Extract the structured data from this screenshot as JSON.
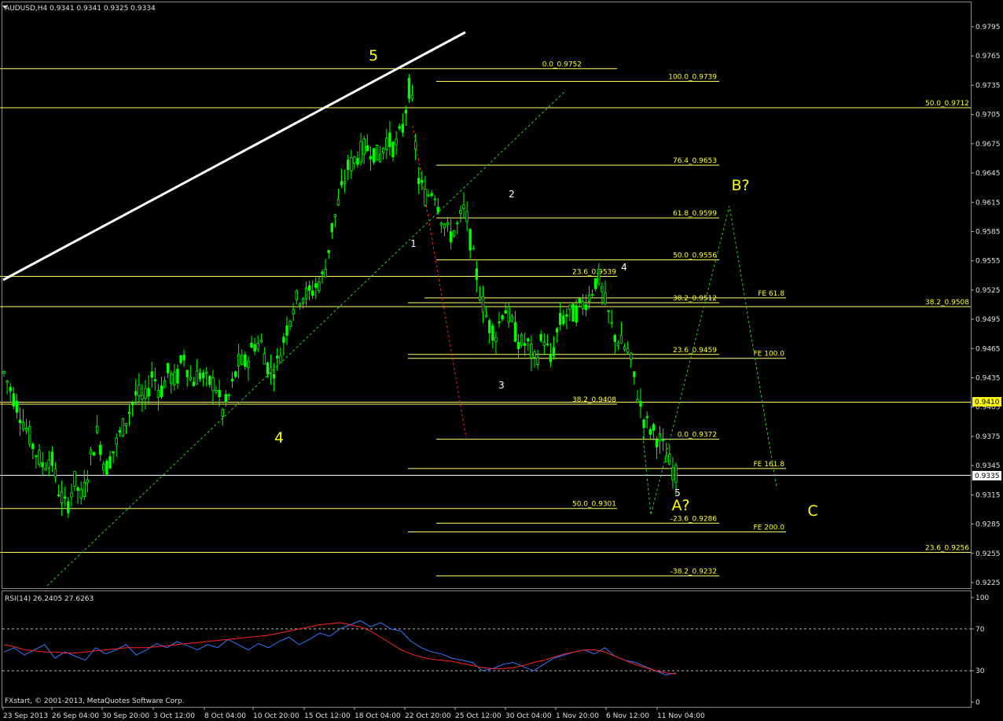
{
  "symbol_header": "AUDUSD,H4  0.9341 0.9341 0.9325 0.9334",
  "rsi_header": "RSI(14) 26.2405 27.6263",
  "copyright": "FXstart, © 2001-2013, MetaQuotes Software Corp.",
  "current_price_label": "0.9335",
  "highlight_price_label": "0.9410",
  "colors": {
    "background": "#000000",
    "candle": "#00ff00",
    "fib_line": "#ffff66",
    "wave_label": "#ffff00",
    "trendline": "#ffffff",
    "channel": "#33cc33",
    "red_dotted": "#ff2222",
    "rsi_line": "#3377ff",
    "rsi_ma": "#ff2222"
  },
  "fib_labels": [
    {
      "text": "0.0_0.9752",
      "price": 0.9752
    },
    {
      "text": "100.0_0.9739",
      "price": 0.9739
    },
    {
      "text": "50.0_0.9712",
      "price": 0.9712
    },
    {
      "text": "76.4_0.9653",
      "price": 0.9653
    },
    {
      "text": "61.8_0.9599",
      "price": 0.9599
    },
    {
      "text": "50.0_0.9556",
      "price": 0.9556
    },
    {
      "text": "23.6_0.9539",
      "price": 0.9539
    },
    {
      "text": "38.2_0.9512",
      "price": 0.9512
    },
    {
      "text": "FE 61.8",
      "price": 0.9517
    },
    {
      "text": "38.2_0.9508",
      "price": 0.9508
    },
    {
      "text": "23.6_0.9459",
      "price": 0.9459
    },
    {
      "text": "FE 100.0",
      "price": 0.9455
    },
    {
      "text": "38.2_0.9408",
      "price": 0.9408
    },
    {
      "text": "0.0_0.9372",
      "price": 0.9372
    },
    {
      "text": "FE 161.8",
      "price": 0.9342
    },
    {
      "text": "50.0_0.9301",
      "price": 0.9301
    },
    {
      "text": "-23.6_0.9286",
      "price": 0.9286
    },
    {
      "text": "FE 200.0",
      "price": 0.9277
    },
    {
      "text": "23.6_0.9256",
      "price": 0.9256
    },
    {
      "text": "-38.2_0.9232",
      "price": 0.9232
    }
  ],
  "wave_labels": [
    {
      "text": "5",
      "size": "big"
    },
    {
      "text": "4",
      "size": "big"
    },
    {
      "text": "B?",
      "size": "big"
    },
    {
      "text": "A?",
      "size": "big"
    },
    {
      "text": "C",
      "size": "big"
    },
    {
      "text": "1",
      "size": "small"
    },
    {
      "text": "2",
      "size": "small"
    },
    {
      "text": "3",
      "size": "small"
    },
    {
      "text": "4",
      "size": "small"
    },
    {
      "text": "5",
      "size": "small"
    }
  ],
  "chart_data": {
    "type": "candlestick",
    "title": "AUDUSD,H4",
    "ohlc_header": {
      "open": 0.9341,
      "high": 0.9341,
      "low": 0.9325,
      "close": 0.9334
    },
    "y_ticks": [
      "0.9795",
      "0.9765",
      "0.9735",
      "0.9705",
      "0.9675",
      "0.9645",
      "0.9615",
      "0.9585",
      "0.9555",
      "0.9525",
      "0.9495",
      "0.9465",
      "0.9435",
      "0.9405",
      "0.9375",
      "0.9345",
      "0.9315",
      "0.9285",
      "0.9255",
      "0.9225"
    ],
    "ylim": [
      0.9212,
      0.9815
    ],
    "x_ticks": [
      "23 Sep 2013",
      "26 Sep 04:00",
      "30 Sep 20:00",
      "3 Oct 12:00",
      "8 Oct 04:00",
      "10 Oct 20:00",
      "15 Oct 12:00",
      "18 Oct 04:00",
      "22 Oct 20:00",
      "25 Oct 12:00",
      "30 Oct 04:00",
      "1 Nov 20:00",
      "6 Nov 12:00",
      "11 Nov 04:00"
    ],
    "price_path": [
      0.944,
      0.942,
      0.94,
      0.938,
      0.936,
      0.9345,
      0.9355,
      0.932,
      0.93,
      0.933,
      0.931,
      0.935,
      0.938,
      0.934,
      0.936,
      0.938,
      0.94,
      0.942,
      0.941,
      0.944,
      0.942,
      0.944,
      0.943,
      0.946,
      0.943,
      0.944,
      0.943,
      0.943,
      0.94,
      0.942,
      0.945,
      0.945,
      0.947,
      0.947,
      0.944,
      0.945,
      0.948,
      0.951,
      0.952,
      0.952,
      0.953,
      0.954,
      0.959,
      0.962,
      0.965,
      0.966,
      0.967,
      0.967,
      0.966,
      0.968,
      0.967,
      0.969,
      0.974,
      0.964,
      0.962,
      0.963,
      0.96,
      0.958,
      0.959,
      0.961,
      0.956,
      0.952,
      0.949,
      0.948,
      0.951,
      0.949,
      0.947,
      0.947,
      0.945,
      0.948,
      0.945,
      0.949,
      0.95,
      0.95,
      0.951,
      0.952,
      0.954,
      0.951,
      0.948,
      0.947,
      0.946,
      0.942,
      0.939,
      0.938,
      0.937,
      0.935,
      0.9335
    ],
    "rsi": {
      "period": 14,
      "values": [
        26.2405,
        27.6263
      ],
      "y_ticks": [
        "100",
        "70",
        "30",
        "0"
      ],
      "levels": [
        70,
        30
      ],
      "rsi_path": [
        48,
        52,
        45,
        50,
        55,
        42,
        48,
        44,
        40,
        52,
        46,
        50,
        55,
        45,
        50,
        56,
        52,
        58,
        54,
        50,
        55,
        52,
        60,
        55,
        50,
        56,
        52,
        58,
        62,
        55,
        60,
        66,
        63,
        70,
        74,
        78,
        72,
        76,
        70,
        68,
        58,
        52,
        48,
        46,
        42,
        40,
        38,
        30,
        32,
        36,
        38,
        34,
        30,
        36,
        42,
        45,
        48,
        50,
        46,
        52,
        44,
        40,
        38,
        34,
        30,
        26,
        28
      ],
      "ma_path": [
        55,
        53,
        50,
        49,
        48,
        48,
        47,
        47,
        48,
        49,
        50,
        51,
        52,
        52,
        52,
        53,
        54,
        55,
        56,
        57,
        58,
        59,
        60,
        61,
        62,
        63,
        64,
        66,
        68,
        70,
        72,
        74,
        75,
        76,
        74,
        72,
        68,
        62,
        56,
        50,
        46,
        43,
        41,
        40,
        39,
        37,
        35,
        33,
        32,
        32,
        33,
        35,
        38,
        40,
        43,
        46,
        48,
        50,
        50,
        48,
        44,
        40,
        36,
        33,
        30,
        28,
        27
      ]
    }
  }
}
